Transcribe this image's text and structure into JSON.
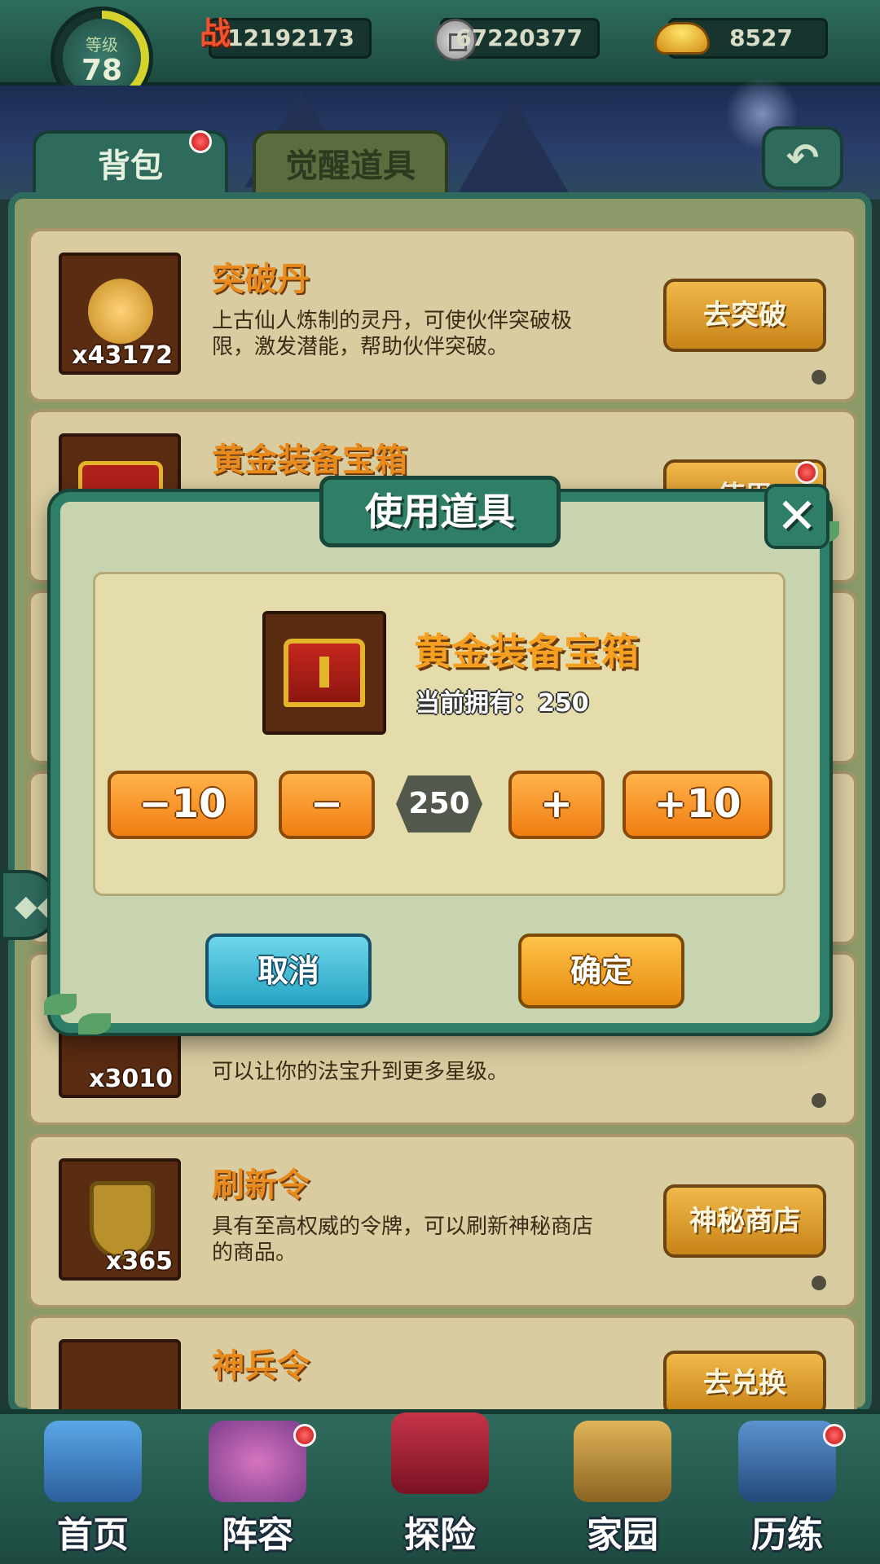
{
  "topbar": {
    "level_label": "等级",
    "level": "78",
    "power": "12192173",
    "copper": "67220377",
    "ingots": "8527"
  },
  "tabs": [
    {
      "label": "背包",
      "active": true,
      "badge": true
    },
    {
      "label": "觉醒道具",
      "active": false,
      "badge": false
    }
  ],
  "items": [
    {
      "name": "突破丹",
      "qty": "x43172",
      "desc": "上古仙人炼制的灵丹，可使伙伴突破极限，激发潜能，帮助伙伴突破。",
      "button": "去突破"
    },
    {
      "name": "黄金装备宝箱",
      "qty": "",
      "desc": "",
      "button": "使用"
    },
    {
      "name": "",
      "qty": "x3010",
      "desc": "可以让你的法宝升到更多星级。",
      "button": ""
    },
    {
      "name": "刷新令",
      "qty": "x365",
      "desc": "具有至高权威的令牌，可以刷新神秘商店的商品。",
      "button": "神秘商店"
    },
    {
      "name": "神兵令",
      "qty": "",
      "desc": "",
      "button": "去兑换"
    }
  ],
  "dialog": {
    "title": "使用道具",
    "close": "✕",
    "item_name": "黄金装备宝箱",
    "owned_label": "当前拥有：250",
    "minus10": "−10",
    "minus": "−",
    "quantity": "250",
    "plus": "+",
    "plus10": "+10",
    "cancel": "取消",
    "confirm": "确定"
  },
  "nav": [
    {
      "label": "首页",
      "color": "#3f86c8",
      "badge": false
    },
    {
      "label": "阵容",
      "color": "#8e5aa6",
      "badge": true
    },
    {
      "label": "探险",
      "color": "#b0283a",
      "badge": false
    },
    {
      "label": "家园",
      "color": "#c9973a",
      "badge": false
    },
    {
      "label": "历练",
      "color": "#3a6fa8",
      "badge": true
    }
  ],
  "colors": {
    "frame_green": "#2f6b5d",
    "item_bg": "#d9cca0",
    "name_orange": "#e88a1c",
    "qty_orange": "#f07e12",
    "cancel_blue": "#26a4c2",
    "confirm_gold": "#e58b10"
  }
}
